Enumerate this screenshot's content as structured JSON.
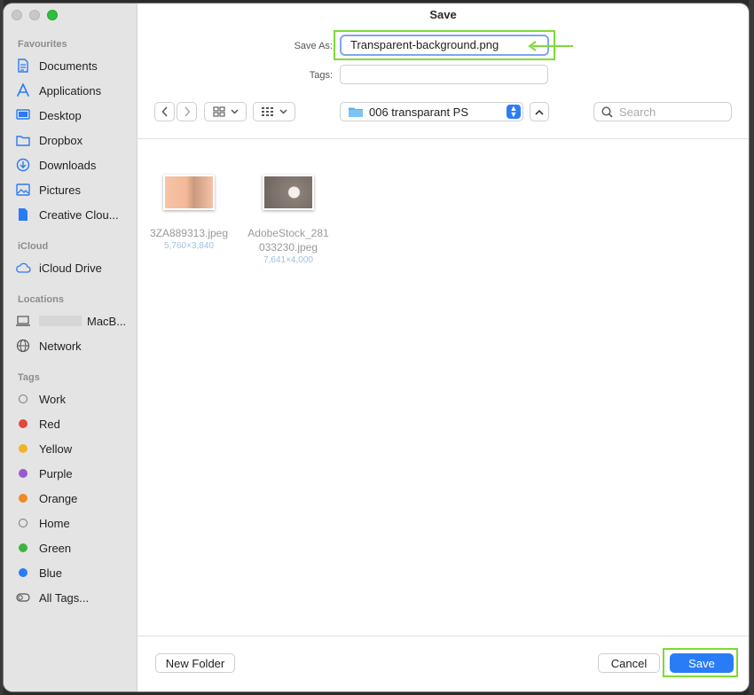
{
  "window": {
    "title": "Save"
  },
  "sidebar": {
    "favourites_label": "Favourites",
    "favourites": [
      {
        "label": "Documents",
        "icon": "document-icon"
      },
      {
        "label": "Applications",
        "icon": "applications-icon"
      },
      {
        "label": "Desktop",
        "icon": "desktop-icon"
      },
      {
        "label": "Dropbox",
        "icon": "folder-icon"
      },
      {
        "label": "Downloads",
        "icon": "download-icon"
      },
      {
        "label": "Pictures",
        "icon": "pictures-icon"
      },
      {
        "label": "Creative Clou...",
        "icon": "file-icon"
      }
    ],
    "icloud_label": "iCloud",
    "icloud": [
      {
        "label": "iCloud Drive",
        "icon": "cloud-icon"
      }
    ],
    "locations_label": "Locations",
    "locations": [
      {
        "label": "MacB...",
        "icon": "laptop-icon"
      },
      {
        "label": "Network",
        "icon": "globe-icon"
      }
    ],
    "tags_label": "Tags",
    "tags": [
      {
        "label": "Work",
        "color": ""
      },
      {
        "label": "Red",
        "color": "#e5473d"
      },
      {
        "label": "Yellow",
        "color": "#f0b429"
      },
      {
        "label": "Purple",
        "color": "#9b59d0"
      },
      {
        "label": "Orange",
        "color": "#f08a24"
      },
      {
        "label": "Home",
        "color": ""
      },
      {
        "label": "Green",
        "color": "#3fb33f"
      },
      {
        "label": "Blue",
        "color": "#2a7cf6"
      },
      {
        "label": "All Tags...",
        "color": ""
      }
    ]
  },
  "form": {
    "save_as_label": "Save As:",
    "save_as_value": "Transparent-background.png",
    "tags_label": "Tags:",
    "tags_value": ""
  },
  "toolbar": {
    "location": "006 transparant PS",
    "search_placeholder": "Search"
  },
  "files": [
    {
      "name_line1": "3ZA889313.jpeg",
      "name_line2": "",
      "dims": "5,760×3,840"
    },
    {
      "name_line1": "AdobeStock_281",
      "name_line2": "033230.jpeg",
      "dims": "7,641×4,000"
    }
  ],
  "buttons": {
    "new_folder": "New Folder",
    "cancel": "Cancel",
    "save": "Save"
  },
  "colors": {
    "accent": "#2a7cf6",
    "annotation": "#7ddb35"
  }
}
